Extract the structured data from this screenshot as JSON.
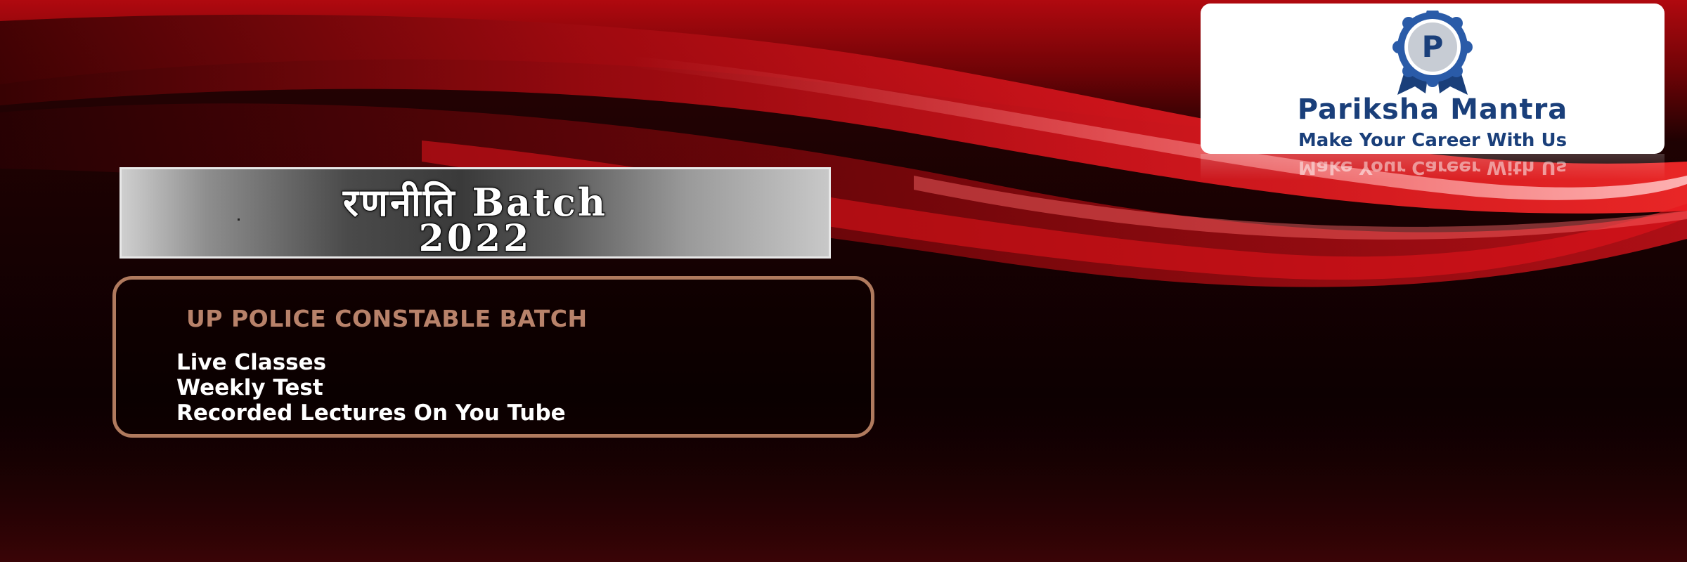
{
  "colors": {
    "background_dark": "#0d0001",
    "wave_red": "#c4121a",
    "wave_highlight": "#ff5a5a",
    "box_border": "#b07a5e",
    "heading_color": "#b8826a",
    "logo_blue": "#1a3f7a"
  },
  "batch_title": {
    "line1": "रणनीति  Batch",
    "line2": "2022"
  },
  "info_box": {
    "heading": "UP POLICE CONSTABLE BATCH",
    "features": [
      "Live Classes",
      "Weekly Test",
      "Recorded Lectures On You Tube"
    ]
  },
  "logo": {
    "badge_letter": "P",
    "name": "Pariksha Mantra",
    "tagline": "Make Your Career With Us",
    "badge_icon": "rosette-badge-icon"
  }
}
